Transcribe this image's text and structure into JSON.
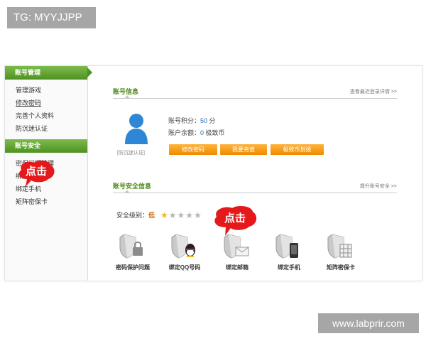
{
  "tag": "TG: MYYJJPP",
  "watermark": "www.labprir.com",
  "sidebar": {
    "section1": "账号管理",
    "items1": [
      "管理游戏",
      "修改密码",
      "完善个人资料",
      "防沉迷认证"
    ],
    "section2": "账号安全",
    "items2": [
      "密保问题管理",
      "绑定邮箱",
      "绑定手机",
      "矩阵密保卡"
    ]
  },
  "callouts": {
    "click_left": "点击",
    "click_right": "点击"
  },
  "account": {
    "title": "账号信息",
    "link": "查看最近登录详情 >>",
    "avatar_caption": "[防沉迷认证]",
    "points_label": "账号积分：",
    "points_value": "50",
    "points_unit": " 分",
    "balance_label": "账户余额：",
    "balance_value": "0",
    "balance_unit": " 极致币",
    "buttons": [
      "修改密码",
      "我要充值",
      "极致币划拨"
    ]
  },
  "security": {
    "title": "账号安全信息",
    "link": "提升账号安全 >>",
    "level_label": "安全级别：",
    "level_value": "低",
    "stars_filled": 1,
    "stars_total": 5,
    "items": [
      {
        "icon": "lock-shield-icon",
        "label": "密码保护问题"
      },
      {
        "icon": "qq-shield-icon",
        "label": "绑定QQ号码"
      },
      {
        "icon": "mail-shield-icon",
        "label": "绑定邮箱"
      },
      {
        "icon": "phone-shield-icon",
        "label": "绑定手机"
      },
      {
        "icon": "card-shield-icon",
        "label": "矩阵密保卡"
      }
    ]
  },
  "colors": {
    "accent_green": "#4e9220",
    "button_orange": "#f39200",
    "callout_red": "#e5191b"
  }
}
